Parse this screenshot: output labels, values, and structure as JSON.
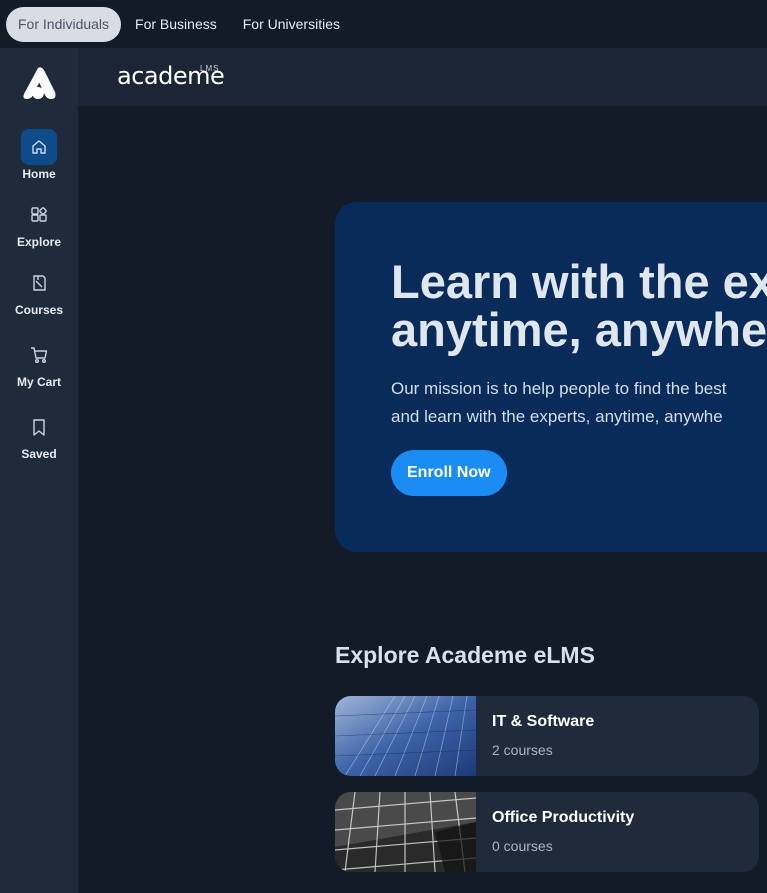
{
  "top_tabs": [
    "For Individuals",
    "For Business",
    "For Universities"
  ],
  "sidebar": {
    "items": [
      {
        "label": "Home",
        "icon": "home-icon"
      },
      {
        "label": "Explore",
        "icon": "explore-icon"
      },
      {
        "label": "Courses",
        "icon": "courses-icon"
      },
      {
        "label": "My Cart",
        "icon": "cart-icon"
      },
      {
        "label": "Saved",
        "icon": "bookmark-icon"
      }
    ]
  },
  "header": {
    "brand": "academe",
    "brand_sup": "LMS"
  },
  "hero": {
    "title_line1": "Learn with the ex",
    "title_line2": "anytime, anywhe",
    "text_line1": "Our mission is to help people to find the best",
    "text_line2": "and learn with the experts, anytime, anywhe",
    "button": "Enroll Now"
  },
  "explore": {
    "title": "Explore Academe eLMS",
    "categories": [
      {
        "name": "IT & Software",
        "count": "2 courses"
      },
      {
        "name": "Office Productivity",
        "count": "0 courses"
      }
    ]
  },
  "colors": {
    "accent": "#1c8cf5",
    "hero_bg": "#082b5a",
    "page_bg": "#131a28",
    "sidebar_bg": "#1f2a3b"
  }
}
